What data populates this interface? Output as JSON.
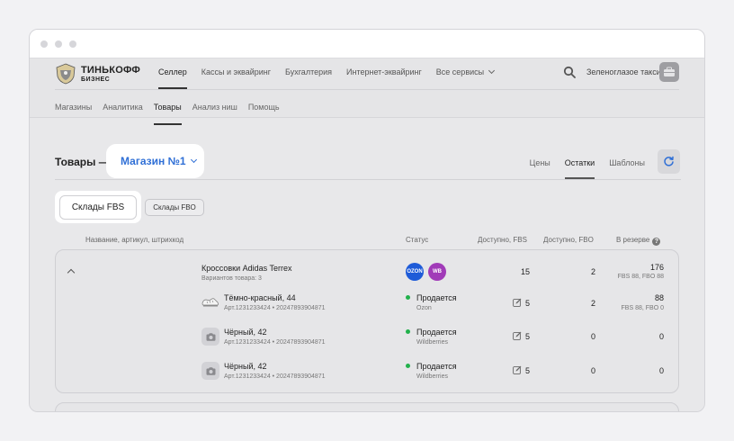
{
  "brand": {
    "line1": "ТИНЬКОФФ",
    "line2": "БИЗНЕС"
  },
  "topnav": {
    "items": [
      {
        "label": "Селлер",
        "active": true
      },
      {
        "label": "Кассы и эквайринг"
      },
      {
        "label": "Бухгалтерия"
      },
      {
        "label": "Интернет-эквайринг"
      },
      {
        "label": "Все сервисы",
        "dropdown": true
      }
    ],
    "company": "Зеленоглазое такси"
  },
  "subnav": {
    "items": [
      {
        "label": "Магазины"
      },
      {
        "label": "Аналитика"
      },
      {
        "label": "Товары",
        "active": true
      },
      {
        "label": "Анализ ниш"
      },
      {
        "label": "Помощь"
      }
    ]
  },
  "page": {
    "title": "Товары —",
    "store": "Магазин №1",
    "tabs": [
      {
        "label": "Цены"
      },
      {
        "label": "Остатки",
        "active": true
      },
      {
        "label": "Шаблоны"
      }
    ],
    "warehouse_fbs": "Склады FBS",
    "warehouse_fbo": "Склады FBO"
  },
  "table": {
    "headers": {
      "name": "Название, артикул, штрихкод",
      "status": "Статус",
      "fbs": "Доступно, FBS",
      "fbo": "Доступно, FBO",
      "reserve": "В резерве"
    },
    "help_glyph": "?",
    "product": {
      "name": "Кроссовки Adidas Terrex",
      "variants": "Вариантов товара: 3",
      "badges": [
        {
          "label": "OZON",
          "color": "#1e5bd8"
        },
        {
          "label": "WB",
          "color": "#a13bb8"
        }
      ],
      "fbs": "15",
      "fbo": "2",
      "reserve": "176",
      "reserve_sub": "FBS 88, FBO 88"
    },
    "variants": [
      {
        "name": "Тёмно-красный, 44",
        "sku": "Арт.1231233424 • 20247893904871",
        "status": "Продается",
        "market": "Ozon",
        "fbs": "5",
        "fbo": "2",
        "reserve": "88",
        "reserve_sub": "FBS 88, FBO 0",
        "thumb": "shoe"
      },
      {
        "name": "Чёрный, 42",
        "sku": "Арт.1231233424 • 20247893904871",
        "status": "Продается",
        "market": "Wildberries",
        "fbs": "5",
        "fbo": "0",
        "reserve": "0",
        "reserve_sub": "",
        "thumb": "camera"
      },
      {
        "name": "Чёрный, 42",
        "sku": "Арт.1231233424 • 20247893904871",
        "status": "Продается",
        "market": "Wildberries",
        "fbs": "5",
        "fbo": "0",
        "reserve": "0",
        "reserve_sub": "",
        "thumb": "camera"
      }
    ]
  },
  "colors": {
    "accent": "#2f6fd6",
    "status_ok": "#22b14c"
  }
}
